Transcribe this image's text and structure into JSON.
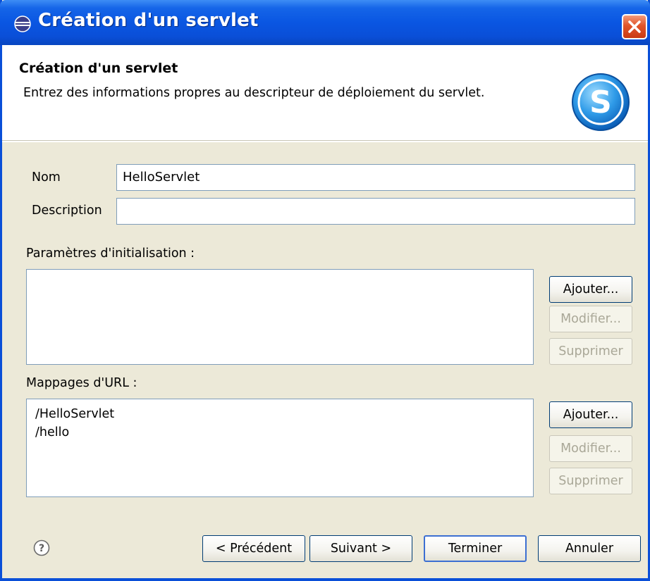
{
  "window": {
    "title": "Création d'un servlet"
  },
  "header": {
    "title": "Création d'un servlet",
    "description": "Entrez des informations propres au descripteur de déploiement du servlet.",
    "logo_icon": "servlet-s-icon"
  },
  "form": {
    "name_label": "Nom",
    "name_value": "HelloServlet",
    "description_label": "Description",
    "description_value": "",
    "init_params_label": "Paramètres d'initialisation :",
    "init_params": [],
    "url_mappings_label": "Mappages d'URL :",
    "url_mappings": [
      "/HelloServlet",
      "/hello"
    ]
  },
  "side_buttons": {
    "add": "Ajouter...",
    "edit": "Modifier...",
    "remove": "Supprimer"
  },
  "footer": {
    "help_icon": "help-icon",
    "back": "< Précédent",
    "next": "Suivant >",
    "finish": "Terminer",
    "cancel": "Annuler"
  },
  "colors": {
    "titlebar": "#0a4fd8",
    "dialog_bg": "#ece9d8",
    "close_button": "#e2542a"
  }
}
